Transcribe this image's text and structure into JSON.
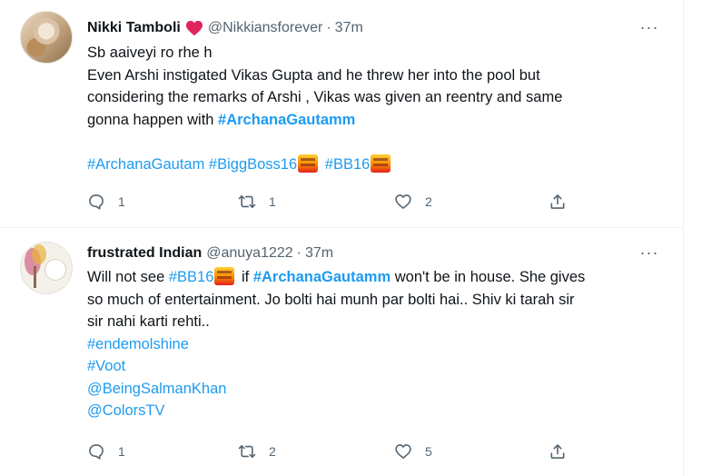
{
  "tweets": [
    {
      "author_name": "Nikki Tamboli",
      "handle": "@Nikkiansforever",
      "separator": "·",
      "time": "37m",
      "more_label": "···",
      "lines": [
        "Sb aaiveyi ro rhe h",
        "Even Arshi instigated Vikas Gupta and he threw her into the pool but",
        "considering the remarks of Arshi , Vikas was given an reentry and same",
        "gonna happen with "
      ],
      "hashtag_inline": "#ArchanaGautamm",
      "hashtags": [
        "#ArchanaGautam",
        "#BiggBoss16",
        "#BB16"
      ],
      "stats": {
        "replies": "1",
        "retweets": "1",
        "likes": "2"
      }
    },
    {
      "author_name": "frustrated Indian",
      "handle": "@anuya1222",
      "separator": "·",
      "time": "37m",
      "more_label": "···",
      "line1_a": "Will not see ",
      "tag_bb16": "#BB16",
      "line1_b": " if ",
      "tag_archana": "#ArchanaGautamm",
      "line1_c": " won't be in house. She gives",
      "line2": "so much of entertainment. Jo bolti hai munh par bolti hai.. Shiv ki tarah sir",
      "line3": "sir nahi karti rehti..",
      "links": [
        "#endemolshine",
        "#Voot",
        "@BeingSalmanKhan",
        "@ColorsTV"
      ],
      "stats": {
        "replies": "1",
        "retweets": "2",
        "likes": "5"
      }
    }
  ],
  "icons": {
    "verified_heart_color": "#e0245e",
    "accent": "#1d9bf0",
    "muted": "#536471"
  }
}
